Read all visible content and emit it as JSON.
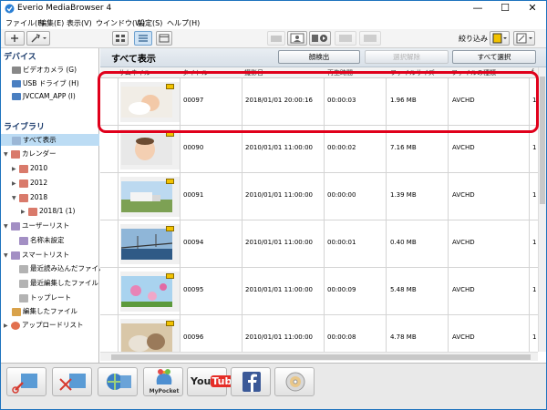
{
  "window": {
    "title": "Everio MediaBrowser 4",
    "controls": [
      "—",
      "☐",
      "✕"
    ]
  },
  "menu": [
    "ファイル(F)",
    "編集(E)",
    "表示(V)",
    "ウインドウ(W)",
    "設定(S)",
    "ヘルプ(H)"
  ],
  "toolbar": {
    "filter_label": "絞り込み"
  },
  "sidebar": {
    "device_heading": "デバイス",
    "devices": [
      "ビデオカメラ (G)",
      "USB ドライブ (H)",
      "JVCCAM_APP (I)"
    ],
    "library_heading": "ライブラリ",
    "tree": [
      {
        "label": "すべて表示"
      },
      {
        "label": "カレンダー"
      },
      {
        "label": "2010"
      },
      {
        "label": "2012"
      },
      {
        "label": "2018"
      },
      {
        "label": "2018/1 (1)"
      },
      {
        "label": "ユーザーリスト"
      },
      {
        "label": "名称未設定"
      },
      {
        "label": "スマートリスト"
      },
      {
        "label": "最近読み込んだファイル"
      },
      {
        "label": "最近編集したファイル"
      },
      {
        "label": "トップレート"
      },
      {
        "label": "編集したファイル"
      },
      {
        "label": "アップロードリスト"
      }
    ]
  },
  "main": {
    "view_title": "すべて表示",
    "buttons": {
      "detect": "顔検出",
      "remove": "選択解除",
      "select_all": "すべて選択"
    },
    "columns": [
      "サムネイル",
      "タイトル",
      "撮影日",
      "再生時間",
      "ファイルサイズ",
      "ファイルの種類",
      "f"
    ],
    "rows": [
      {
        "title": "00097",
        "date": "2018/01/01 20:00:16",
        "duration": "00:00:03",
        "size": "1.96 MB",
        "type": "AVCHD",
        "extra": "1"
      },
      {
        "title": "00090",
        "date": "2010/01/01 11:00:00",
        "duration": "00:00:02",
        "size": "7.16 MB",
        "type": "AVCHD",
        "extra": "1"
      },
      {
        "title": "00091",
        "date": "2010/01/01 11:00:00",
        "duration": "00:00:00",
        "size": "1.39 MB",
        "type": "AVCHD",
        "extra": "1"
      },
      {
        "title": "00094",
        "date": "2010/01/01 11:00:00",
        "duration": "00:00:01",
        "size": "0.40 MB",
        "type": "AVCHD",
        "extra": "1"
      },
      {
        "title": "00095",
        "date": "2010/01/01 11:00:00",
        "duration": "00:00:09",
        "size": "5.48 MB",
        "type": "AVCHD",
        "extra": "1"
      },
      {
        "title": "00096",
        "date": "2010/01/01 11:00:00",
        "duration": "00:00:08",
        "size": "4.78 MB",
        "type": "AVCHD",
        "extra": "1"
      }
    ]
  },
  "bottom": {
    "mypocket_label": "MyPocket",
    "youtube_you": "You",
    "youtube_tube": "Tube"
  },
  "colors": {
    "highlight": "#e0001b",
    "selection": "#bcdcf4",
    "titlebar_border": "#1e73be"
  }
}
